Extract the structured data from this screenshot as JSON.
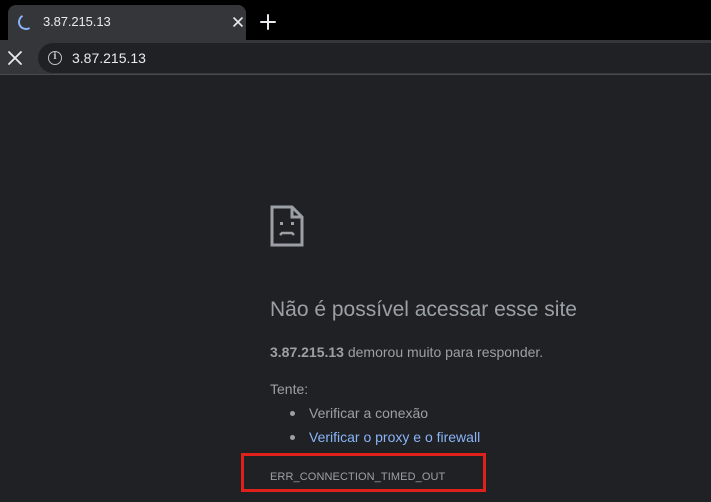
{
  "tab": {
    "title": "3.87.215.13"
  },
  "toolbar": {
    "url": "3.87.215.13"
  },
  "error": {
    "heading": "Não é possível acessar esse site",
    "host": "3.87.215.13",
    "description_rest": " demorou muito para responder.",
    "try_label": "Tente:",
    "suggestions": [
      {
        "label": "Verificar a conexão",
        "link": false
      },
      {
        "label": "Verificar o proxy e o firewall",
        "link": true
      }
    ],
    "code": "ERR_CONNECTION_TIMED_OUT"
  },
  "colors": {
    "background": "#202124",
    "link": "#8ab4f8",
    "highlight_box": "#e0201b"
  },
  "icons": {
    "tab_loading": "loading-spinner-icon",
    "tab_close": "close-icon",
    "new_tab": "plus-icon",
    "stop": "stop-x-icon",
    "site_info": "info-icon",
    "error": "sad-page-icon"
  }
}
